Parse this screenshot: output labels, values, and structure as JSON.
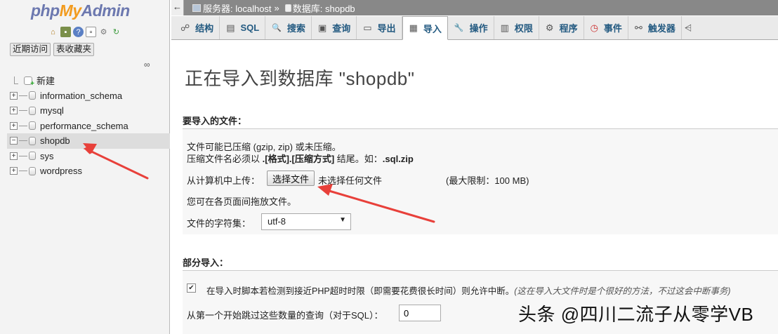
{
  "nav": {
    "logo_php": "php",
    "logo_my": "My",
    "logo_admin": "Admin",
    "tabs": [
      "近期访问",
      "表收藏夹"
    ],
    "icons": [
      "home-icon",
      "exit-icon",
      "help-icon",
      "docs-icon",
      "settings-icon",
      "reload-icon"
    ],
    "tree": [
      {
        "label": "新建",
        "type": "new"
      },
      {
        "label": "information_schema",
        "type": "db"
      },
      {
        "label": "mysql",
        "type": "db"
      },
      {
        "label": "performance_schema",
        "type": "db"
      },
      {
        "label": "shopdb",
        "type": "db",
        "selected": true
      },
      {
        "label": "sys",
        "type": "db"
      },
      {
        "label": "wordpress",
        "type": "db"
      }
    ]
  },
  "breadcrumb": {
    "server_label": "服务器: localhost",
    "separator": "»",
    "db_label": "数据库: shopdb"
  },
  "menu": {
    "tabs": [
      {
        "label": "结构",
        "icon": "structure-icon",
        "glyph": "☍"
      },
      {
        "label": "SQL",
        "icon": "sql-icon",
        "glyph": "▤"
      },
      {
        "label": "搜索",
        "icon": "search-icon",
        "glyph": "🔍"
      },
      {
        "label": "查询",
        "icon": "query-icon",
        "glyph": "▣"
      },
      {
        "label": "导出",
        "icon": "export-icon",
        "glyph": "▭"
      },
      {
        "label": "导入",
        "icon": "import-icon",
        "glyph": "▦",
        "active": true
      },
      {
        "label": "操作",
        "icon": "wrench-icon",
        "glyph": "🔧"
      },
      {
        "label": "权限",
        "icon": "privileges-icon",
        "glyph": "▥"
      },
      {
        "label": "程序",
        "icon": "routines-icon",
        "glyph": "⚙"
      },
      {
        "label": "事件",
        "icon": "events-icon",
        "glyph": "◷"
      },
      {
        "label": "触发器",
        "icon": "triggers-icon",
        "glyph": "⚯"
      },
      {
        "label": "",
        "icon": "more-icon",
        "glyph": "⩤"
      }
    ]
  },
  "main": {
    "title": "正在导入到数据库 \"shopdb\"",
    "file_section": {
      "heading": "要导入的文件：",
      "compress_note": "文件可能已压缩 (gzip, zip) 或未压缩。",
      "name_note_prefix": "压缩文件名必须以 ",
      "name_note_format": ".[格式].[压缩方式]",
      "name_note_mid": " 结尾。如：",
      "name_note_example": ".sql.zip",
      "upload_label": "从计算机中上传：",
      "choose_button": "选择文件",
      "no_file": "未选择任何文件",
      "max_limit": "(最大限制：100 MB)",
      "drag_note": "您可在各页面间拖放文件。",
      "charset_label": "文件的字符集：",
      "charset_value": "utf-8"
    },
    "partial_section": {
      "heading": "部分导入：",
      "interrupt_label": "在导入时脚本若检测到接近PHP超时时限（即需要花费很长时间）则允许中断。",
      "interrupt_hint": "(这在导入大文件时是个很好的方法，不过这会中断事务)",
      "interrupt_checked": true,
      "skip_label": "从第一个开始跳过这些数量的查询（对于SQL）：",
      "skip_value": "0"
    }
  },
  "watermark": "头条 @四川二流子从零学VB",
  "colors": {
    "logo_blue": "#6c78af",
    "logo_orange": "#f29b1e",
    "link_blue": "#235a81",
    "annotation_red": "#e8403a",
    "breadcrumb_bg": "#888888"
  }
}
